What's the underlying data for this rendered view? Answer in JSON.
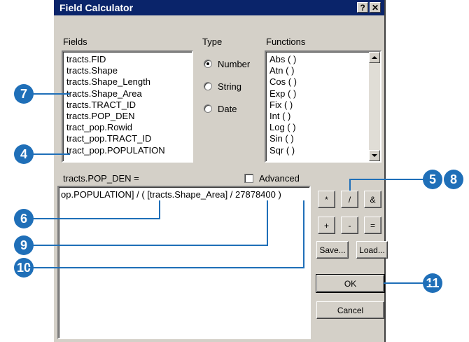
{
  "window": {
    "title": "Field Calculator",
    "help_label": "?",
    "close_label": "✕"
  },
  "fields": {
    "label": "Fields",
    "items": [
      "tracts.FID",
      "tracts.Shape",
      "tracts.Shape_Length",
      "tracts.Shape_Area",
      "tracts.TRACT_ID",
      "tracts.POP_DEN",
      "tract_pop.Rowid",
      "tract_pop.TRACT_ID",
      "tract_pop.POPULATION"
    ]
  },
  "type": {
    "label": "Type",
    "options": [
      "Number",
      "String",
      "Date"
    ],
    "selected": "Number"
  },
  "functions": {
    "label": "Functions",
    "items": [
      "Abs ( )",
      "Atn ( )",
      "Cos ( )",
      "Exp ( )",
      "Fix ( )",
      "Int ( )",
      "Log ( )",
      "Sin ( )",
      "Sqr ( )"
    ]
  },
  "expression": {
    "label": "tracts.POP_DEN =",
    "value": "op.POPULATION] / ( [tracts.Shape_Area] / 27878400 )"
  },
  "advanced": {
    "label": "Advanced",
    "checked": false
  },
  "operators": [
    "*",
    "/",
    "&",
    "+",
    "-",
    "="
  ],
  "buttons": {
    "save": "Save...",
    "load": "Load...",
    "ok": "OK",
    "cancel": "Cancel"
  },
  "callouts": [
    "7",
    "4",
    "6",
    "9",
    "10",
    "5",
    "8",
    "11"
  ],
  "colors": {
    "callout": "#1f6fb8",
    "titlebar": "#0a246a",
    "dialog": "#d4d0c8"
  }
}
